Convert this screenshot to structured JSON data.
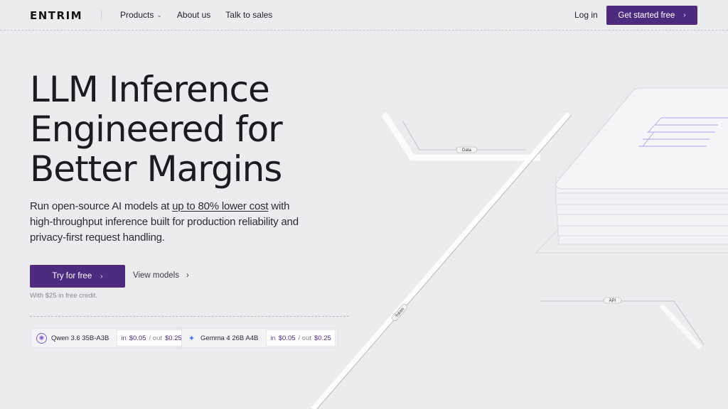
{
  "header": {
    "logo_text": "ENTRIM",
    "nav": [
      {
        "label": "Products"
      },
      {
        "label": "About us"
      },
      {
        "label": "Talk to sales"
      }
    ],
    "login_label": "Log in",
    "cta_label": "Get started free"
  },
  "hero": {
    "headline_lines": [
      "LLM Inference",
      "Engineered for",
      "Better Margins"
    ],
    "sub_before": "Run open-source AI models at ",
    "sub_link": "up to 80% lower cost",
    "sub_after": " with high-throughput inference built for production reliability and privacy-first request handling.",
    "try_label": "Try for free",
    "view_models_label": "View models",
    "credit_note": "With $25 in free credit."
  },
  "models": [
    {
      "name": "Qwen 3.6 35B-A3B",
      "in_label": "in",
      "in_price": "$0.05",
      "out_label": "/ out",
      "out_price": "$0.25",
      "icon": "qwen-logo-icon",
      "icon_color": "#7b5cd6"
    },
    {
      "name": "Gemma 4 26B A4B",
      "in_label": "in",
      "in_price": "$0.05",
      "out_label": "/ out",
      "out_price": "$0.25",
      "icon": "gemma-logo-icon",
      "icon_color": "#3d7bf0"
    }
  ],
  "diagram": {
    "labels": {
      "data": "Data",
      "token": "Token",
      "api": "API"
    }
  },
  "colors": {
    "accent": "#4d2c80",
    "background": "#ececee"
  }
}
